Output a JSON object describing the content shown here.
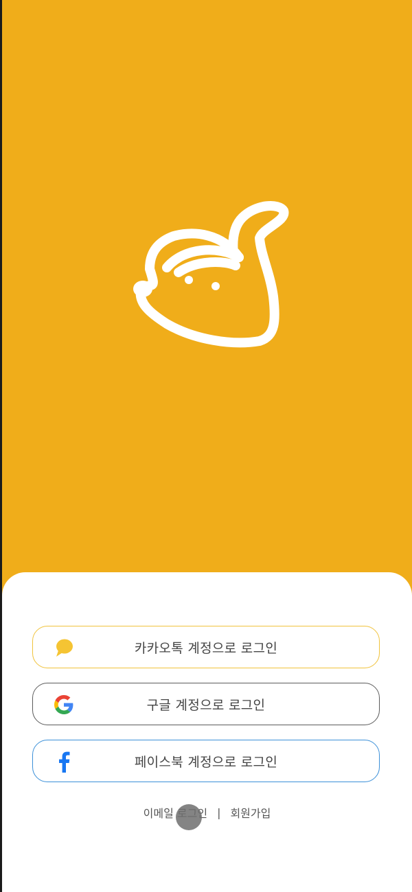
{
  "brand": {
    "accent": "#f0ad1a"
  },
  "logo": {
    "icon": "mascot-logo-icon"
  },
  "buttons": {
    "kakao": {
      "label": "카카오톡 계정으로 로그인",
      "icon": "kakao-talk-icon",
      "color": "#f0c23a"
    },
    "google": {
      "label": "구글 계정으로 로그인",
      "icon": "google-icon",
      "color": "#5b5b5b"
    },
    "facebook": {
      "label": "페이스북 계정으로 로그인",
      "icon": "facebook-icon",
      "color": "#1877f2"
    }
  },
  "links": {
    "email_login": "이메일 로그인",
    "separator": "|",
    "signup": "회원가입"
  }
}
